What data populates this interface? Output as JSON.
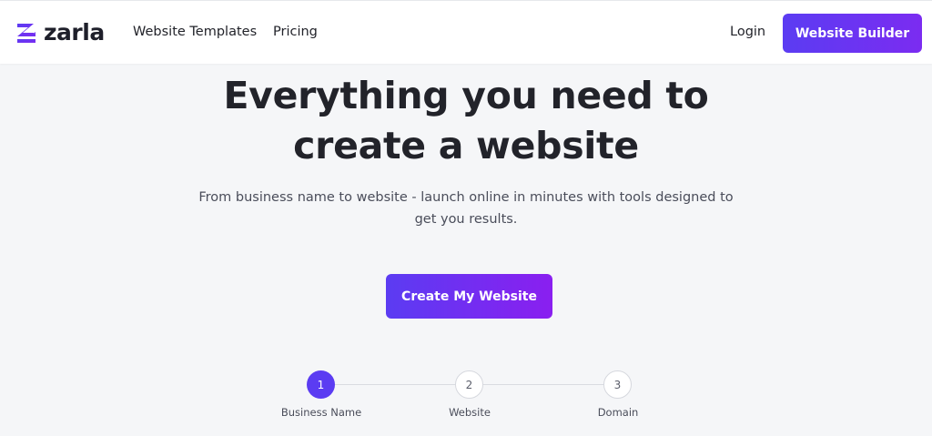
{
  "brand": {
    "name": "zarla",
    "accent": "#5b3cf2",
    "accent_end": "#8a1ff0"
  },
  "nav": {
    "templates": "Website Templates",
    "pricing": "Pricing",
    "login": "Login",
    "builder_button": "Website Builder"
  },
  "hero": {
    "title_line1": "Everything you need to",
    "title_line2": "create a website",
    "subtitle": "From business name to website - launch online in minutes with tools designed to get you results.",
    "cta": "Create My Website"
  },
  "steps": [
    {
      "number": "1",
      "label": "Business Name",
      "state": "active"
    },
    {
      "number": "2",
      "label": "Website",
      "state": "pending"
    },
    {
      "number": "3",
      "label": "Domain",
      "state": "pending"
    }
  ]
}
